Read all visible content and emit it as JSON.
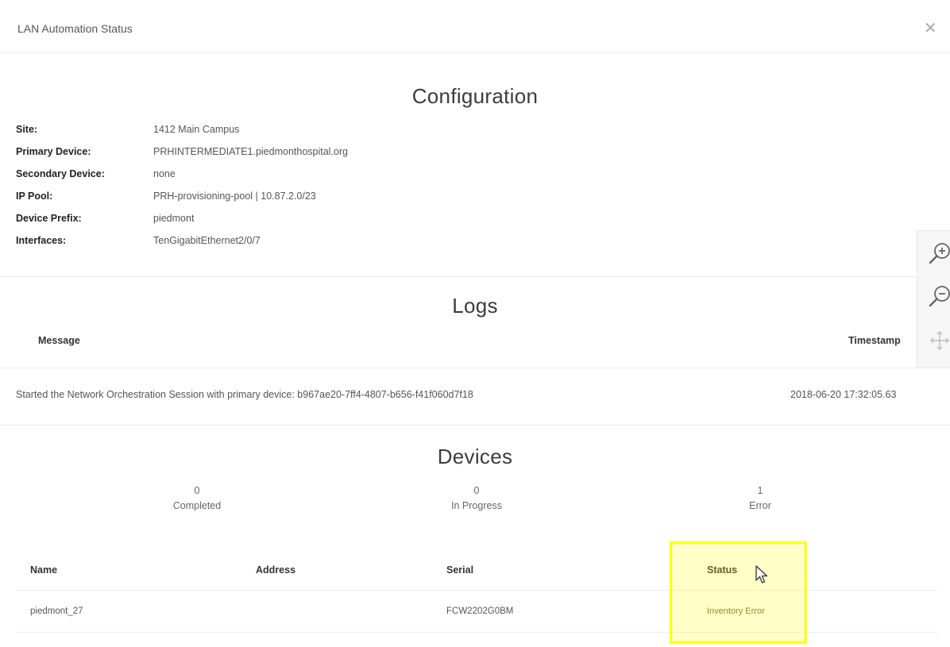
{
  "dialog": {
    "title": "LAN Automation Status",
    "close_icon": "close-icon"
  },
  "configuration": {
    "title": "Configuration",
    "rows": [
      {
        "label": "Site:",
        "value": "1412 Main Campus"
      },
      {
        "label": "Primary Device:",
        "value": "PRHINTERMEDIATE1.piedmonthospital.org"
      },
      {
        "label": "Secondary Device:",
        "value": "none"
      },
      {
        "label": "IP Pool:",
        "value": "PRH-provisioning-pool | 10.87.2.0/23"
      },
      {
        "label": "Device Prefix:",
        "value": "piedmont"
      },
      {
        "label": "Interfaces:",
        "value": "TenGigabitEthernet2/0/7"
      }
    ]
  },
  "logs": {
    "title": "Logs",
    "columns": {
      "message": "Message",
      "timestamp": "Timestamp"
    },
    "rows": [
      {
        "message": "Started the Network Orchestration Session with primary device: b967ae20-7ff4-4807-b656-f41f060d7f18",
        "timestamp": "2018-06-20 17:32:05.63"
      }
    ]
  },
  "devices": {
    "title": "Devices",
    "stats": [
      {
        "count": "0",
        "label": "Completed"
      },
      {
        "count": "0",
        "label": "In Progress"
      },
      {
        "count": "1",
        "label": "Error"
      }
    ],
    "columns": {
      "name": "Name",
      "address": "Address",
      "serial": "Serial",
      "status": "Status"
    },
    "rows": [
      {
        "name": "piedmont_27",
        "address": "",
        "serial": "FCW2202G0BM",
        "status": "Inventory Error"
      }
    ]
  },
  "zoom_controls": {
    "zoom_in_icon": "zoom-in-icon",
    "zoom_out_icon": "zoom-out-icon",
    "fit_icon": "move-fit-icon"
  },
  "colors": {
    "highlight": "#ffff00",
    "status_error_text": "#7a7a3a"
  }
}
